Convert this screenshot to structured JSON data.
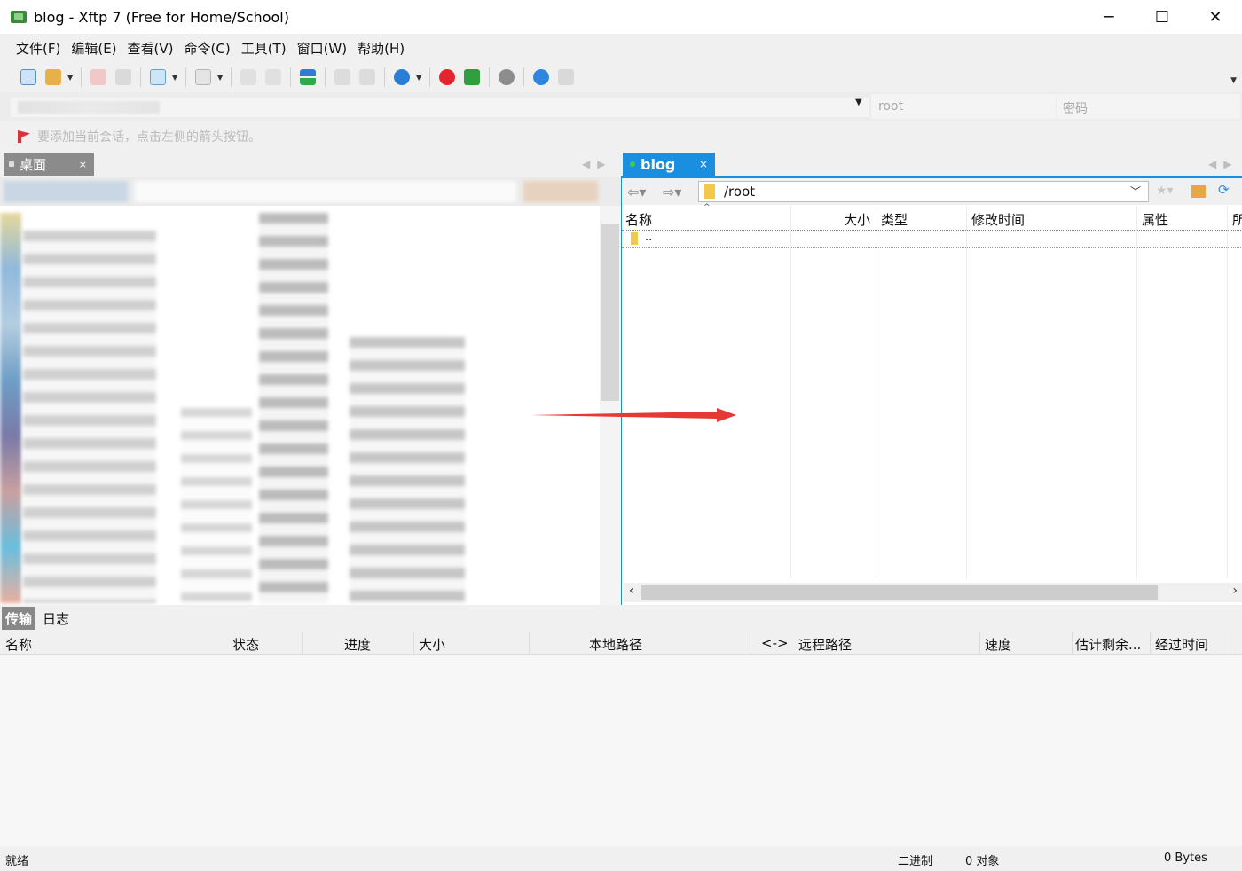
{
  "window": {
    "title": "blog - Xftp 7 (Free for Home/School)",
    "min_label": "─",
    "max_label": "☐",
    "close_label": "✕"
  },
  "menu": {
    "items": [
      "文件(F)",
      "编辑(E)",
      "查看(V)",
      "命令(C)",
      "工具(T)",
      "窗口(W)",
      "帮助(H)"
    ]
  },
  "address": {
    "user_placeholder": "root",
    "password_placeholder": "密码"
  },
  "hint": {
    "text": "要添加当前会话，点击左侧的箭头按钮。"
  },
  "local_tab": {
    "label": "桌面",
    "close": "×"
  },
  "remote_tab": {
    "label": "blog",
    "close": "×"
  },
  "remote": {
    "path": "/root",
    "columns": [
      "名称",
      "大小",
      "类型",
      "修改时间",
      "属性",
      "所"
    ],
    "rows": [
      {
        "name": ".."
      }
    ]
  },
  "bottom_tabs": {
    "transfer": "传输",
    "log": "日志"
  },
  "transfer_columns": [
    "名称",
    "状态",
    "进度",
    "大小",
    "本地路径",
    "<->",
    "远程路径",
    "速度",
    "估计剩余...",
    "经过时间"
  ],
  "status": {
    "ready": "就绪",
    "mode": "二进制",
    "objects": "0 对象",
    "bytes": "0 Bytes"
  },
  "colors": {
    "accent": "#1a8fe0",
    "arrow": "#e53935"
  },
  "toolbar_icons": [
    "new-session-icon",
    "open-folder-icon",
    "disconnect-icon",
    "reconnect-icon",
    "session-properties-icon",
    "terminal-icon",
    "copy-icon",
    "paste-icon",
    "sync-icon",
    "upload-icon",
    "download-icon",
    "globe-icon",
    "xshell-icon",
    "xftp-icon",
    "settings-icon",
    "help-icon",
    "chat-icon"
  ]
}
